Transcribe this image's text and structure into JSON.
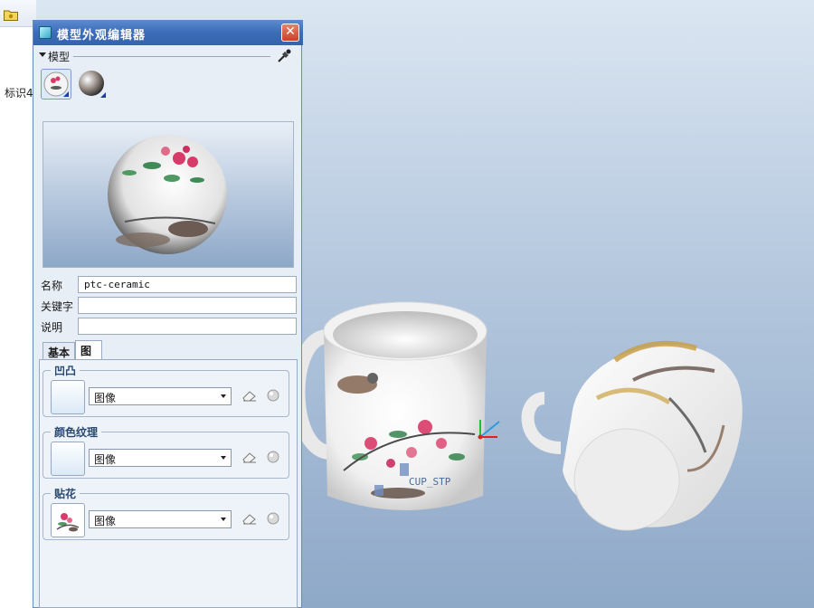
{
  "app": {
    "strip_label": "标识4"
  },
  "dialog": {
    "title": "模型外观编辑器",
    "close_glyph": "✕",
    "section": "模型",
    "thumbnails": [
      "ptc-ceramic",
      "metal"
    ],
    "fields": {
      "name_label": "名称",
      "name_value": "ptc-ceramic",
      "keyword_label": "关键字",
      "keyword_value": "",
      "description_label": "说明",
      "description_value": ""
    },
    "tabs": [
      {
        "label": "基本"
      },
      {
        "label": "图"
      }
    ],
    "groups": [
      {
        "title": "凹凸",
        "select_value": "图像"
      },
      {
        "title": "颜色纹理",
        "select_value": "图像"
      },
      {
        "title": "贴花",
        "select_value": "图像"
      }
    ]
  },
  "viewport": {
    "csys_label": "CUP_STP"
  },
  "icons": {
    "folder": "folder-icon",
    "eyedropper": "eyedropper-icon",
    "eraser": "eraser-icon",
    "sphere": "sphere-icon"
  },
  "colors": {
    "titlebar": "#3c6cb8",
    "close_button": "#c84226",
    "panel_bg": "#e8eef6",
    "viewport_top": "#dbe6f2",
    "viewport_bottom": "#8ea8c8",
    "group_title": "#29496f"
  }
}
